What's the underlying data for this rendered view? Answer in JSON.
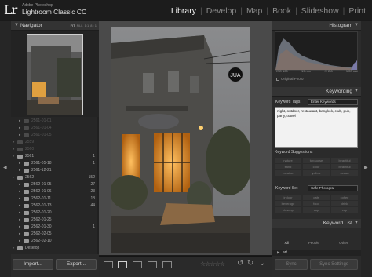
{
  "app": {
    "logo": "Lr",
    "brand": "Adobe Photoshop",
    "name": "Lightroom Classic CC"
  },
  "modules": [
    "Library",
    "Develop",
    "Map",
    "Book",
    "Slideshow",
    "Print"
  ],
  "active_module": "Library",
  "navigator": {
    "title": "Navigator",
    "zoom_options": [
      "FIT",
      "FILL",
      "1:1",
      "8 : 1"
    ],
    "active_zoom": "FIT"
  },
  "folders": [
    {
      "name": "2561-01-01",
      "count": "",
      "dim": true
    },
    {
      "name": "2561-01-04",
      "count": "",
      "dim": true
    },
    {
      "name": "2561-01-05",
      "count": "",
      "dim": true
    },
    {
      "name": "2559",
      "count": "",
      "dim": true
    },
    {
      "name": "2560",
      "count": "",
      "dim": true
    },
    {
      "name": "2561",
      "count": "1",
      "dim": false
    },
    {
      "name": "2561-05-18",
      "count": "1",
      "dim": false
    },
    {
      "name": "2561-12-21",
      "count": "",
      "dim": false
    },
    {
      "name": "2562",
      "count": "152",
      "dim": false
    },
    {
      "name": "2562-01-05",
      "count": "27",
      "dim": false
    },
    {
      "name": "2562-01-06",
      "count": "23",
      "dim": false
    },
    {
      "name": "2562-01-11",
      "count": "18",
      "dim": false
    },
    {
      "name": "2562-01-13",
      "count": "44",
      "dim": false
    },
    {
      "name": "2562-01-20",
      "count": "",
      "dim": false
    },
    {
      "name": "2562-01-25",
      "count": "",
      "dim": false
    },
    {
      "name": "2562-01-30",
      "count": "1",
      "dim": false
    },
    {
      "name": "2562-02-05",
      "count": "",
      "dim": false
    },
    {
      "name": "2562-02-10",
      "count": "",
      "dim": false
    },
    {
      "name": "Desktop",
      "count": "",
      "dim": false
    }
  ],
  "left_buttons": {
    "import": "Import...",
    "export": "Export..."
  },
  "photo": {
    "sign_text": "JUA"
  },
  "histogram": {
    "title": "Histogram",
    "iso": "ISO 100",
    "focal": "19 mm",
    "aperture": "f / 2.8",
    "shutter": "1/20 sec",
    "original_photo": "Original Photo"
  },
  "keywording": {
    "title": "Keywording",
    "tags_label": "Keyword Tags",
    "tags_mode": "Enter Keywords",
    "keywords_text": "night, outdoor, restaurant, bangkok, club, pub, party, travel",
    "suggestions_label": "Keyword Suggestions",
    "suggestions": [
      "nature",
      "turquoise",
      "beautiful",
      "sand",
      "color",
      "beautiful",
      "vacation",
      "yellow",
      "ocean"
    ],
    "set_label": "Keyword Set",
    "set_value": "Cafe Photogra",
    "set_keywords": [
      "indoor",
      "cafe",
      "coffee",
      "beverage",
      "food",
      "drink",
      "closeup",
      "cup",
      "cup"
    ]
  },
  "keyword_list": {
    "title": "Keyword List",
    "filters": [
      "All",
      "People",
      "Other"
    ],
    "active_filter": "All",
    "first_item": "art"
  },
  "right_buttons": {
    "sync": "Sync",
    "sync_settings": "Sync Settings"
  },
  "toolbar": {
    "stars": "☆☆☆☆☆"
  },
  "colors": {
    "accent": "#f2f2f2",
    "panel": "#2b2b2b",
    "background": "#1a1a1a"
  }
}
